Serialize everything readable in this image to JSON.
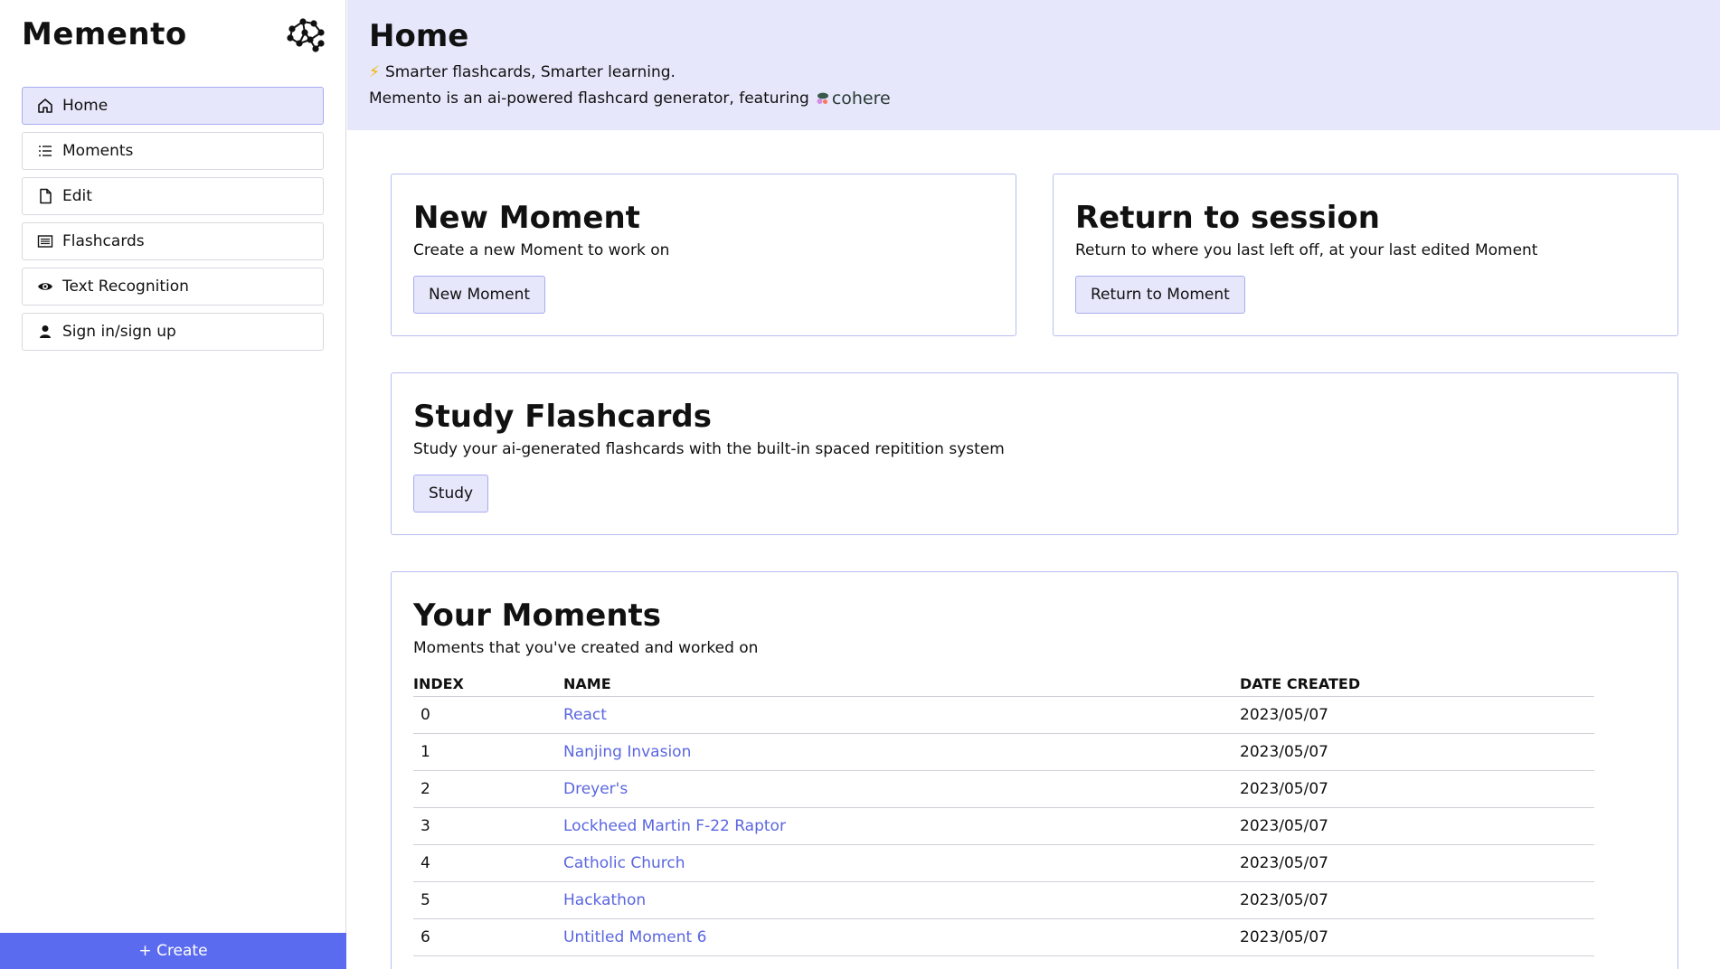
{
  "sidebar": {
    "brand": "Memento",
    "items": [
      {
        "label": "Home",
        "icon": "home-icon",
        "active": true
      },
      {
        "label": "Moments",
        "icon": "list-icon"
      },
      {
        "label": "Edit",
        "icon": "document-icon"
      },
      {
        "label": "Flashcards",
        "icon": "cards-icon"
      },
      {
        "label": "Text Recognition",
        "icon": "eye-icon"
      },
      {
        "label": "Sign in/sign up",
        "icon": "user-icon"
      }
    ],
    "create_label": "+ Create"
  },
  "hero": {
    "title": "Home",
    "tagline_emoji": "⚡",
    "tagline": "Smarter flashcards, Smarter learning.",
    "description": "Memento is an ai-powered flashcard generator, featuring",
    "partner": "cohere"
  },
  "cards": {
    "new_moment": {
      "title": "New Moment",
      "subtitle": "Create a new Moment to work on",
      "button": "New Moment"
    },
    "return_session": {
      "title": "Return to session",
      "subtitle": "Return to where you last left off, at your last edited Moment",
      "button": "Return to Moment"
    },
    "study": {
      "title": "Study Flashcards",
      "subtitle": "Study your ai-generated flashcards with the built-in spaced repitition system",
      "button": "Study"
    },
    "moments": {
      "title": "Your Moments",
      "subtitle": "Moments that you've created and worked on",
      "columns": [
        "INDEX",
        "NAME",
        "DATE CREATED"
      ],
      "rows": [
        {
          "index": "0",
          "name": "React",
          "date": "2023/05/07"
        },
        {
          "index": "1",
          "name": "Nanjing Invasion",
          "date": "2023/05/07"
        },
        {
          "index": "2",
          "name": "Dreyer's",
          "date": "2023/05/07"
        },
        {
          "index": "3",
          "name": "Lockheed Martin F-22 Raptor",
          "date": "2023/05/07"
        },
        {
          "index": "4",
          "name": "Catholic Church",
          "date": "2023/05/07"
        },
        {
          "index": "5",
          "name": "Hackathon",
          "date": "2023/05/07"
        },
        {
          "index": "6",
          "name": "Untitled Moment 6",
          "date": "2023/05/07"
        }
      ]
    }
  },
  "colors": {
    "accent": "#5b6bef",
    "hero_bg": "#e6e7fb",
    "link": "#5a66e0"
  }
}
